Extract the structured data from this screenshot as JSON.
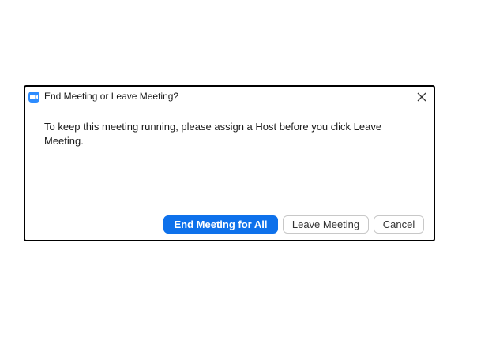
{
  "dialog": {
    "title": "End Meeting or Leave Meeting?",
    "app_icon": "zoom-video-camera-icon",
    "close_icon": "close-icon",
    "message": "To keep this meeting running, please assign a Host before you click Leave Meeting.",
    "buttons": {
      "end_for_all": "End Meeting for All",
      "leave": "Leave Meeting",
      "cancel": "Cancel"
    }
  },
  "colors": {
    "brand": "#2D8CFF",
    "primary_button": "#0E71EB",
    "border": "#000000"
  }
}
